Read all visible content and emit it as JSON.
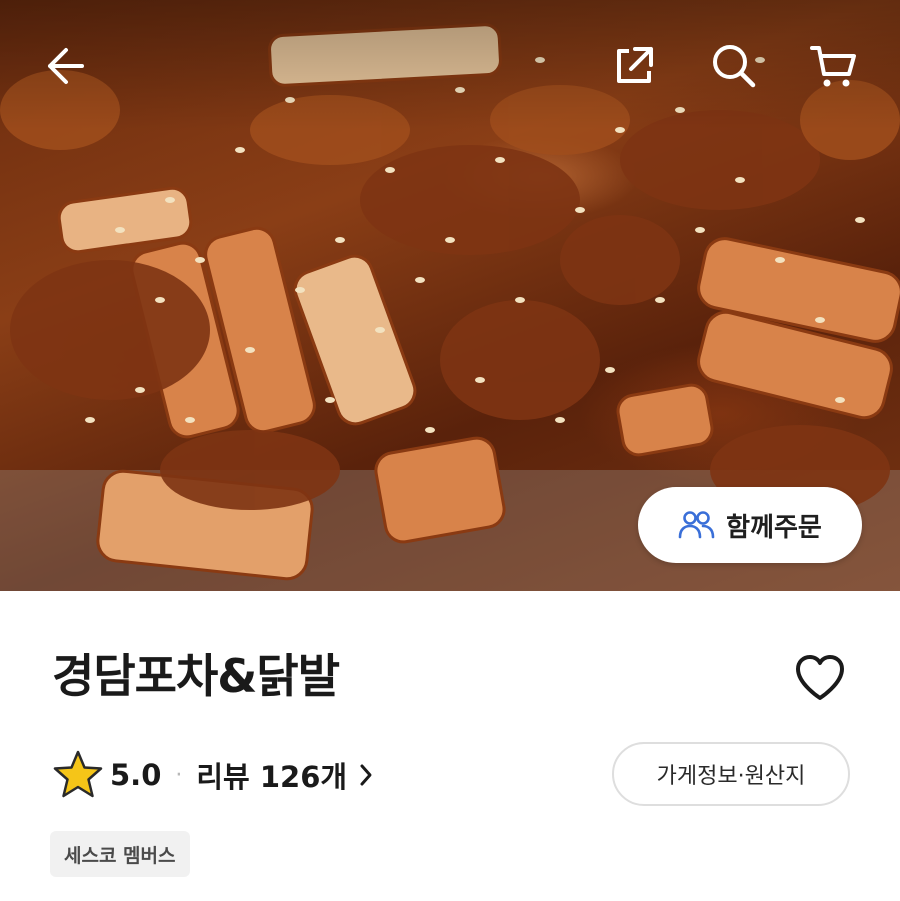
{
  "header": {
    "back_icon": "arrow-left-icon",
    "share_icon": "share-external-icon",
    "search_icon": "search-icon",
    "cart_icon": "cart-icon"
  },
  "hero": {
    "image": "food-photo",
    "group_order": {
      "label": "함께주문",
      "icon": "people-icon",
      "icon_color": "#3a6fd8"
    }
  },
  "store": {
    "name": "경담포차&닭발",
    "rating": "5.0",
    "separator": "·",
    "review_label": "리뷰 126개",
    "info_button": "가게정보·원산지",
    "badge": "세스코 멤버스"
  },
  "colors": {
    "star": "#f5c518",
    "text_primary": "#1a1a1a"
  }
}
